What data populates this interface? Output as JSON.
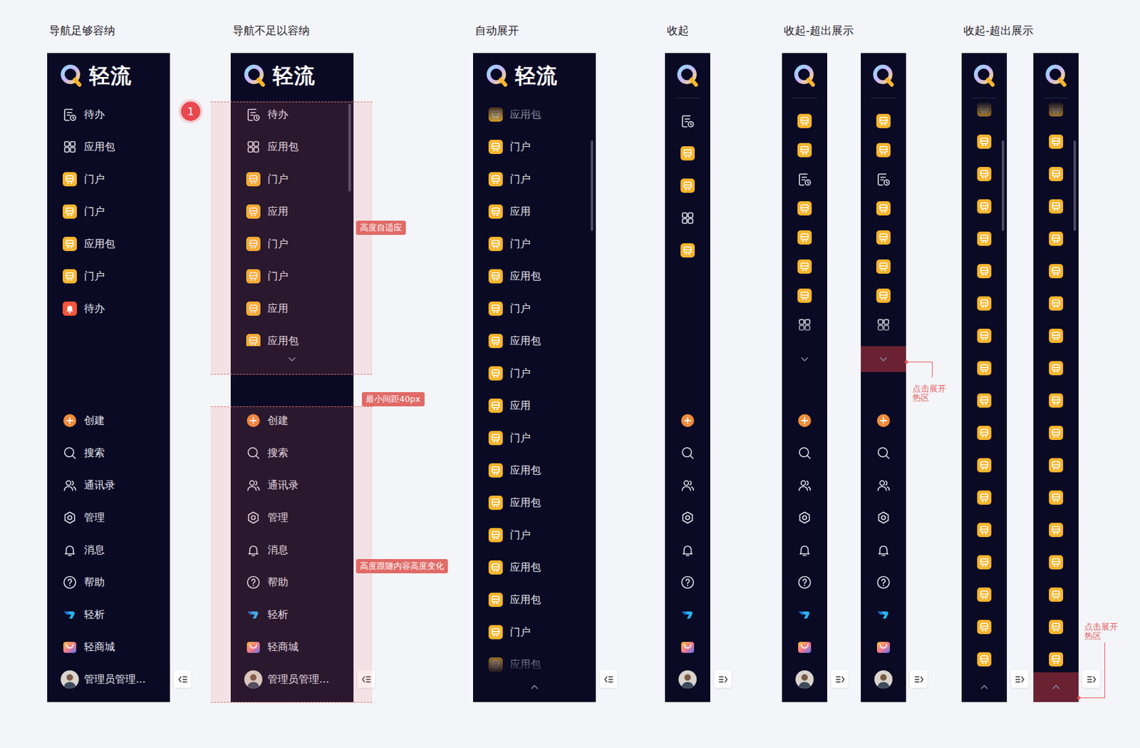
{
  "sections": [
    {
      "title": "导航足够容纳",
      "panels": [
        {
          "collapsed": false,
          "logo": "轻流",
          "fade_top": false,
          "fade_bottom": false,
          "more": "none",
          "toggle": "collapse",
          "top_items": [
            {
              "label": "待办",
              "kind": "todo"
            },
            {
              "label": "应用包",
              "kind": "grid"
            },
            {
              "label": "门户",
              "kind": "app"
            },
            {
              "label": "门户",
              "kind": "app"
            },
            {
              "label": "应用包",
              "kind": "app"
            },
            {
              "label": "门户",
              "kind": "app"
            },
            {
              "label": "待办",
              "kind": "alert"
            }
          ],
          "bottom_items": [
            {
              "label": "创建",
              "kind": "create"
            },
            {
              "label": "搜索",
              "kind": "search"
            },
            {
              "label": "通讯录",
              "kind": "contacts"
            },
            {
              "label": "管理",
              "kind": "admin"
            },
            {
              "label": "消息",
              "kind": "bell"
            },
            {
              "label": "帮助",
              "kind": "help"
            },
            {
              "label": "轻析",
              "kind": "analytics"
            },
            {
              "label": "轻商城",
              "kind": "mall"
            },
            {
              "label": "管理员管理...",
              "kind": "avatar"
            }
          ]
        }
      ]
    },
    {
      "title": "导航不足以容纳",
      "panels": [
        {
          "collapsed": false,
          "logo": "轻流",
          "fade_top": false,
          "fade_bottom": false,
          "more": "down",
          "toggle": "collapse",
          "scrollbar": {
            "offset": 0.02,
            "size": 0.32
          },
          "top_items": [
            {
              "label": "待办",
              "kind": "todo"
            },
            {
              "label": "应用包",
              "kind": "grid"
            },
            {
              "label": "门户",
              "kind": "app"
            },
            {
              "label": "应用",
              "kind": "app"
            },
            {
              "label": "门户",
              "kind": "app"
            },
            {
              "label": "门户",
              "kind": "app"
            },
            {
              "label": "应用",
              "kind": "app"
            },
            {
              "label": "应用包",
              "kind": "app"
            }
          ],
          "bottom_items": [
            {
              "label": "创建",
              "kind": "create"
            },
            {
              "label": "搜索",
              "kind": "search"
            },
            {
              "label": "通讯录",
              "kind": "contacts"
            },
            {
              "label": "管理",
              "kind": "admin"
            },
            {
              "label": "消息",
              "kind": "bell"
            },
            {
              "label": "帮助",
              "kind": "help"
            },
            {
              "label": "轻析",
              "kind": "analytics"
            },
            {
              "label": "轻商城",
              "kind": "mall"
            },
            {
              "label": "管理员管理...",
              "kind": "avatar"
            }
          ]
        }
      ]
    },
    {
      "title": "自动展开",
      "panels": [
        {
          "collapsed": false,
          "logo": "轻流",
          "fade_top": true,
          "fade_bottom": true,
          "more": "up",
          "toggle": "collapse",
          "scrollbar": {
            "offset": 0.07,
            "size": 0.15
          },
          "top_items": [
            {
              "label": "应用包",
              "kind": "app"
            },
            {
              "label": "门户",
              "kind": "app"
            },
            {
              "label": "门户",
              "kind": "app"
            },
            {
              "label": "应用",
              "kind": "app"
            },
            {
              "label": "门户",
              "kind": "app"
            },
            {
              "label": "应用包",
              "kind": "app"
            },
            {
              "label": "门户",
              "kind": "app"
            },
            {
              "label": "应用包",
              "kind": "app"
            },
            {
              "label": "门户",
              "kind": "app"
            },
            {
              "label": "应用",
              "kind": "app"
            },
            {
              "label": "门户",
              "kind": "app"
            },
            {
              "label": "应用包",
              "kind": "app"
            },
            {
              "label": "应用包",
              "kind": "app"
            },
            {
              "label": "门户",
              "kind": "app"
            },
            {
              "label": "应用包",
              "kind": "app"
            },
            {
              "label": "应用包",
              "kind": "app"
            },
            {
              "label": "门户",
              "kind": "app"
            },
            {
              "label": "应用包",
              "kind": "app"
            }
          ],
          "bottom_items": []
        }
      ]
    },
    {
      "title": "收起",
      "panels": [
        {
          "collapsed": true,
          "fade_top": false,
          "fade_bottom": false,
          "more": "none",
          "toggle": "expand",
          "top_items": [
            {
              "kind": "todo"
            },
            {
              "kind": "app"
            },
            {
              "kind": "app"
            },
            {
              "kind": "grid"
            },
            {
              "kind": "app"
            }
          ],
          "bottom_items": [
            {
              "kind": "create"
            },
            {
              "kind": "search"
            },
            {
              "kind": "contacts"
            },
            {
              "kind": "admin"
            },
            {
              "kind": "bell"
            },
            {
              "kind": "help"
            },
            {
              "kind": "analytics"
            },
            {
              "kind": "mall"
            },
            {
              "kind": "avatar"
            }
          ]
        }
      ]
    },
    {
      "title": "收起-超出展示",
      "panels": [
        {
          "collapsed": true,
          "fade_top": false,
          "fade_bottom": true,
          "more": "down",
          "toggle": "expand",
          "top_items": [
            {
              "kind": "app"
            },
            {
              "kind": "app"
            },
            {
              "kind": "todo"
            },
            {
              "kind": "app"
            },
            {
              "kind": "app"
            },
            {
              "kind": "app"
            },
            {
              "kind": "app"
            },
            {
              "kind": "grid"
            },
            {
              "kind": "app"
            }
          ],
          "bottom_items": [
            {
              "kind": "create"
            },
            {
              "kind": "search"
            },
            {
              "kind": "contacts"
            },
            {
              "kind": "admin"
            },
            {
              "kind": "bell"
            },
            {
              "kind": "help"
            },
            {
              "kind": "analytics"
            },
            {
              "kind": "mall"
            },
            {
              "kind": "avatar"
            }
          ]
        },
        {
          "collapsed": true,
          "fade_top": false,
          "fade_bottom": true,
          "more": "down",
          "toggle": "expand",
          "hotspot": {
            "place": "chevron",
            "label": "点击展开热区"
          },
          "top_items": [
            {
              "kind": "app"
            },
            {
              "kind": "app"
            },
            {
              "kind": "todo"
            },
            {
              "kind": "app"
            },
            {
              "kind": "app"
            },
            {
              "kind": "app"
            },
            {
              "kind": "app"
            },
            {
              "kind": "grid"
            },
            {
              "kind": "app"
            }
          ],
          "bottom_items": [
            {
              "kind": "create"
            },
            {
              "kind": "search"
            },
            {
              "kind": "contacts"
            },
            {
              "kind": "admin"
            },
            {
              "kind": "bell"
            },
            {
              "kind": "help"
            },
            {
              "kind": "analytics"
            },
            {
              "kind": "mall"
            },
            {
              "kind": "avatar"
            }
          ]
        }
      ]
    },
    {
      "title": "收起-超出展示",
      "panels": [
        {
          "collapsed": true,
          "fade_top": true,
          "fade_bottom": false,
          "more": "up",
          "toggle": "expand",
          "scrollbar": {
            "offset": 0.07,
            "size": 0.15
          },
          "top_items": [
            {
              "kind": "app"
            },
            {
              "kind": "app"
            },
            {
              "kind": "app"
            },
            {
              "kind": "app"
            },
            {
              "kind": "app"
            },
            {
              "kind": "app"
            },
            {
              "kind": "app"
            },
            {
              "kind": "app"
            },
            {
              "kind": "app"
            },
            {
              "kind": "app"
            },
            {
              "kind": "app"
            },
            {
              "kind": "app"
            },
            {
              "kind": "app"
            },
            {
              "kind": "app"
            },
            {
              "kind": "app"
            },
            {
              "kind": "app"
            },
            {
              "kind": "app"
            },
            {
              "kind": "app"
            }
          ],
          "bottom_items": []
        },
        {
          "collapsed": true,
          "fade_top": true,
          "fade_bottom": false,
          "more": "up",
          "toggle": "expand",
          "scrollbar": {
            "offset": 0.07,
            "size": 0.15
          },
          "hotspot": {
            "place": "bottom",
            "label": "点击展开热区"
          },
          "top_items": [
            {
              "kind": "app"
            },
            {
              "kind": "app"
            },
            {
              "kind": "app"
            },
            {
              "kind": "app"
            },
            {
              "kind": "app"
            },
            {
              "kind": "app"
            },
            {
              "kind": "app"
            },
            {
              "kind": "app"
            },
            {
              "kind": "app"
            },
            {
              "kind": "app"
            },
            {
              "kind": "app"
            },
            {
              "kind": "app"
            },
            {
              "kind": "app"
            },
            {
              "kind": "app"
            },
            {
              "kind": "app"
            },
            {
              "kind": "app"
            },
            {
              "kind": "app"
            },
            {
              "kind": "app"
            }
          ],
          "bottom_items": []
        }
      ]
    }
  ],
  "annotations": [
    {
      "text": "1"
    },
    {
      "text": "高度自适应"
    },
    {
      "text": "最小间距40px"
    },
    {
      "text": "高度跟随内容高度变化"
    }
  ]
}
